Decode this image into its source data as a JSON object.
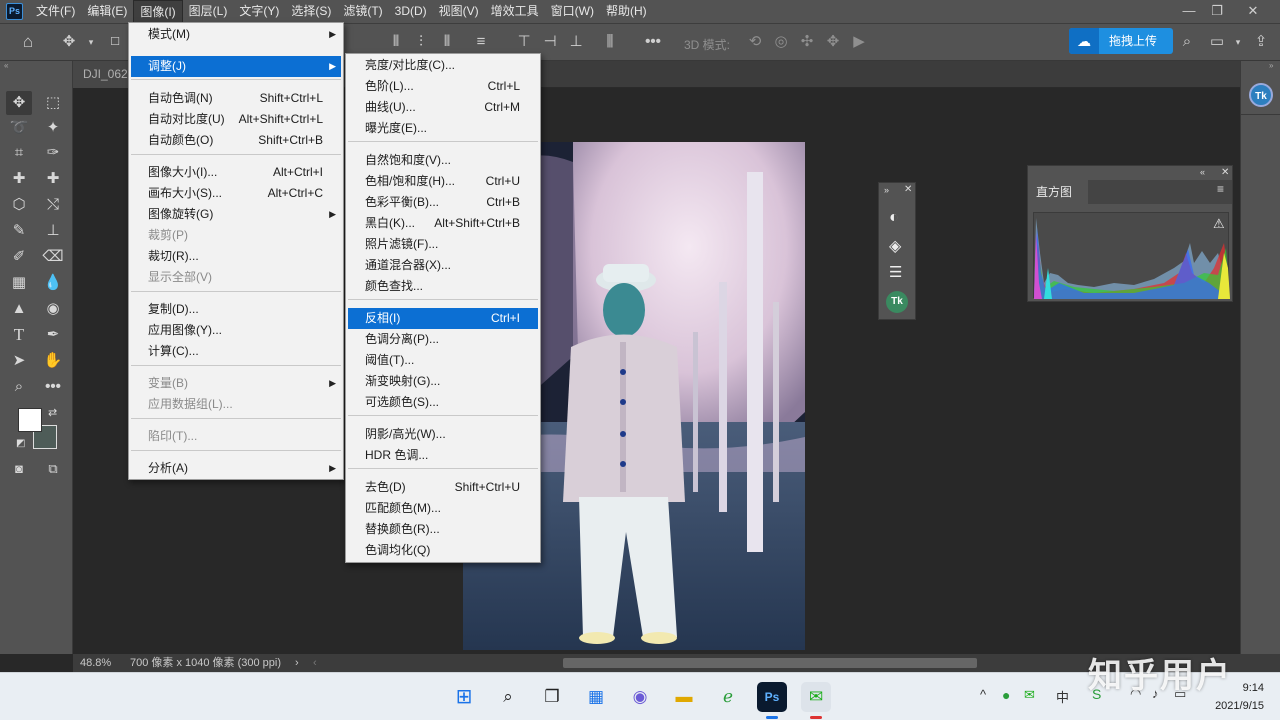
{
  "app": {
    "logo": "Ps"
  },
  "menubar": {
    "items": [
      "文件(F)",
      "编辑(E)",
      "图像(I)",
      "图层(L)",
      "文字(Y)",
      "选择(S)",
      "滤镜(T)",
      "3D(D)",
      "视图(V)",
      "增效工具",
      "窗口(W)",
      "帮助(H)"
    ],
    "active_index": 2
  },
  "window_controls": {
    "minimize": "—",
    "restore": "❐",
    "close": "✕"
  },
  "options_bar": {
    "mode_label": "3D 模式:",
    "upload_label": "拖拽上传"
  },
  "document": {
    "tab_label": "DJI_0621"
  },
  "status": {
    "zoom": "48.8%",
    "info": "700 像素 x 1040 像素 (300 ppi)",
    "arrow": "›",
    "left_arrow": "‹"
  },
  "image_menu": {
    "items": [
      {
        "label": "模式(M)",
        "submenu": true
      },
      {
        "label": "调整(J)",
        "submenu": true,
        "highlighted": true
      },
      {
        "label": "自动色调(N)",
        "shortcut": "Shift+Ctrl+L"
      },
      {
        "label": "自动对比度(U)",
        "shortcut": "Alt+Shift+Ctrl+L"
      },
      {
        "label": "自动颜色(O)",
        "shortcut": "Shift+Ctrl+B"
      },
      {
        "label": "图像大小(I)...",
        "shortcut": "Alt+Ctrl+I"
      },
      {
        "label": "画布大小(S)...",
        "shortcut": "Alt+Ctrl+C"
      },
      {
        "label": "图像旋转(G)",
        "submenu": true
      },
      {
        "label": "裁剪(P)",
        "disabled": true
      },
      {
        "label": "裁切(R)..."
      },
      {
        "label": "显示全部(V)",
        "disabled": true
      },
      {
        "label": "复制(D)..."
      },
      {
        "label": "应用图像(Y)..."
      },
      {
        "label": "计算(C)..."
      },
      {
        "label": "变量(B)",
        "submenu": true,
        "disabled": true
      },
      {
        "label": "应用数据组(L)...",
        "disabled": true
      },
      {
        "label": "陷印(T)...",
        "disabled": true
      },
      {
        "label": "分析(A)",
        "submenu": true
      }
    ]
  },
  "adjust_menu": {
    "items": [
      {
        "label": "亮度/对比度(C)..."
      },
      {
        "label": "色阶(L)...",
        "shortcut": "Ctrl+L"
      },
      {
        "label": "曲线(U)...",
        "shortcut": "Ctrl+M"
      },
      {
        "label": "曝光度(E)..."
      },
      {
        "label": "自然饱和度(V)..."
      },
      {
        "label": "色相/饱和度(H)...",
        "shortcut": "Ctrl+U"
      },
      {
        "label": "色彩平衡(B)...",
        "shortcut": "Ctrl+B"
      },
      {
        "label": "黑白(K)...",
        "shortcut": "Alt+Shift+Ctrl+B"
      },
      {
        "label": "照片滤镜(F)..."
      },
      {
        "label": "通道混合器(X)..."
      },
      {
        "label": "颜色查找..."
      },
      {
        "label": "反相(I)",
        "shortcut": "Ctrl+I",
        "highlighted": true
      },
      {
        "label": "色调分离(P)..."
      },
      {
        "label": "阈值(T)..."
      },
      {
        "label": "渐变映射(G)..."
      },
      {
        "label": "可选颜色(S)..."
      },
      {
        "label": "阴影/高光(W)..."
      },
      {
        "label": "HDR 色调..."
      },
      {
        "label": "去色(D)",
        "shortcut": "Shift+Ctrl+U"
      },
      {
        "label": "匹配颜色(M)..."
      },
      {
        "label": "替换颜色(R)..."
      },
      {
        "label": "色调均化(Q)"
      }
    ]
  },
  "histogram_panel": {
    "title": "直方图",
    "warning": "⚠"
  },
  "taskbar": {
    "time": "9:14",
    "date": "2021/9/15",
    "ime": "中",
    "watermark": "知乎用户"
  }
}
